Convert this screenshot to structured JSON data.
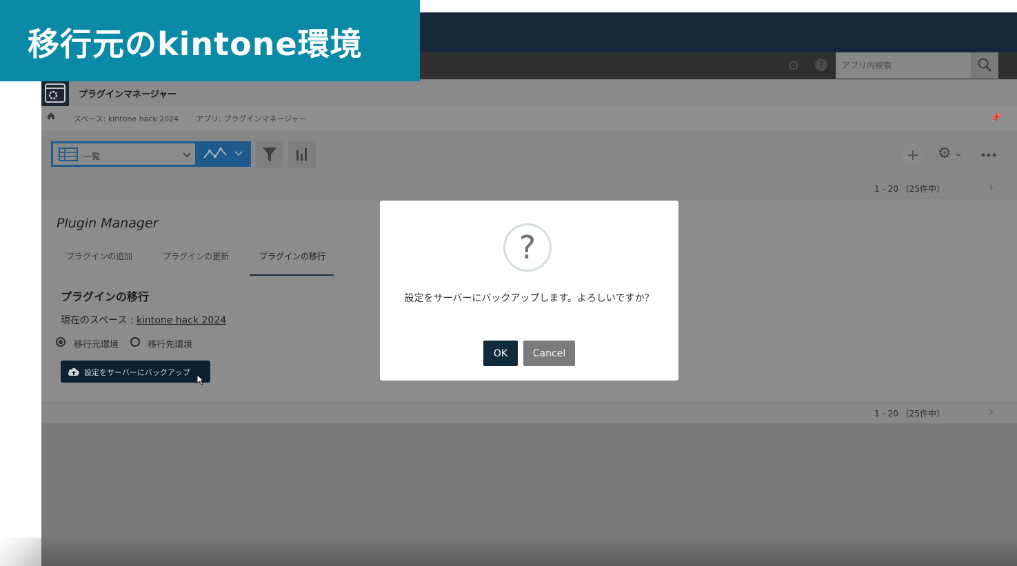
{
  "banner": {
    "title": "移行元のkintone環境"
  },
  "header": {
    "search_placeholder": "アプリ内検索"
  },
  "app": {
    "title": "プラグインマネージャー",
    "breadcrumb": [
      {
        "label": "スペース: kintone hack 2024"
      },
      {
        "label": "アプリ: プラグインマネージャー"
      }
    ]
  },
  "toolbar": {
    "view_label": "一覧"
  },
  "pagination": {
    "top": "1 - 20 （25件中）",
    "bottom": "1 - 20 （25件中）"
  },
  "plugin_manager": {
    "title": "Plugin Manager",
    "tabs": [
      {
        "label": "プラグインの追加"
      },
      {
        "label": "プラグインの更新"
      },
      {
        "label": "プラグインの移行",
        "active": true
      }
    ],
    "section_title": "プラグインの移行",
    "space_label": "現在のスペース : ",
    "space_name": "kintone hack 2024",
    "radio_options": [
      {
        "label": "移行元環境",
        "selected": true
      },
      {
        "label": "移行先環境",
        "selected": false
      }
    ],
    "backup_button": "設定をサーバーにバックアップ"
  },
  "dialog": {
    "icon": "?",
    "message": "設定をサーバーにバックアップします。よろしいですか？",
    "ok": "OK",
    "cancel": "Cancel"
  },
  "colors": {
    "banner": "#0a8aa6",
    "primary_button": "#0f2b3a",
    "view_selector": "#1e5a8c",
    "top_nav": "#14283a"
  }
}
